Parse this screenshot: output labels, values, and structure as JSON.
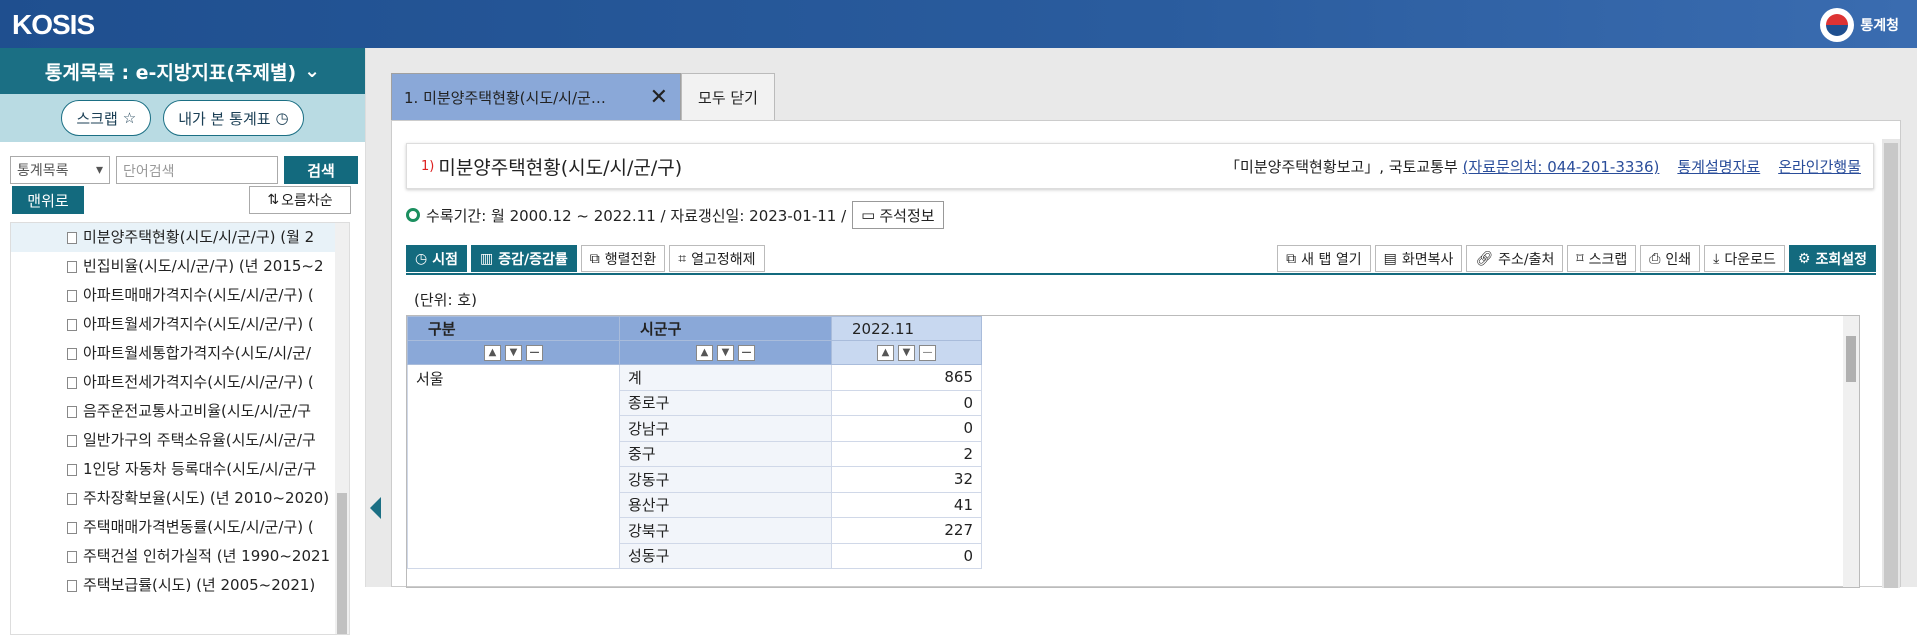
{
  "header": {
    "logo": "KOSIS",
    "brand": "통계청"
  },
  "sidebar": {
    "title": "통계목록 :  e-지방지표(주제별)",
    "scrap_label": "스크랩",
    "recent_label": "내가 본 통계표",
    "search_scope": "통계목록",
    "search_placeholder": "단어검색",
    "search_button": "검색",
    "up_button": "맨위로",
    "sort_button": "오름차순",
    "items": [
      {
        "label": "미분양주택현황(시도/시/군/구) (월 2"
      },
      {
        "label": "빈집비율(시도/시/군/구) (년 2015~2"
      },
      {
        "label": "아파트매매가격지수(시도/시/군/구) ("
      },
      {
        "label": "아파트월세가격지수(시도/시/군/구) ("
      },
      {
        "label": "아파트월세통합가격지수(시도/시/군/"
      },
      {
        "label": "아파트전세가격지수(시도/시/군/구) ("
      },
      {
        "label": "음주운전교통사고비율(시도/시/군/구"
      },
      {
        "label": "일반가구의 주택소유율(시도/시/군/구"
      },
      {
        "label": "1인당 자동차 등록대수(시도/시/군/구"
      },
      {
        "label": "주차장확보율(시도) (년 2010~2020)"
      },
      {
        "label": "주택매매가격변동률(시도/시/군/구) ("
      },
      {
        "label": "주택건설 인허가실적 (년 1990~2021"
      },
      {
        "label": "주택보급률(시도) (년 2005~2021)"
      }
    ]
  },
  "tabs": {
    "active": "1. 미분양주택현황(시도/시/군…",
    "close_all": "모두 닫기"
  },
  "content": {
    "title_num": "1)",
    "title": "미분양주택현황(시도/시/군/구)",
    "source": "「미분양주택현황보고」, 국토교통부",
    "contact": "(자료문의처: 044-201-3336)",
    "stat_doc": "통계설명자료",
    "online": "온라인간행물",
    "period": "수록기간: 월 2000.12 ~ 2022.11 / 자료갱신일: 2023-01-11 /",
    "note_button": "주석정보",
    "unit": "(단위: 호)"
  },
  "toolbar_left": [
    "시점",
    "증감/증감률",
    "행렬전환",
    "열고정해제"
  ],
  "toolbar_right": [
    "새 탭 열기",
    "화면복사",
    "주소/출처",
    "스크랩",
    "인쇄",
    "다운로드",
    "조회설정"
  ],
  "table": {
    "headers": [
      "구분",
      "시군구",
      "2022.11"
    ],
    "region": "서울",
    "rows": [
      {
        "district": "계",
        "value": "865"
      },
      {
        "district": "종로구",
        "value": "0"
      },
      {
        "district": "강남구",
        "value": "0"
      },
      {
        "district": "중구",
        "value": "2"
      },
      {
        "district": "강동구",
        "value": "32"
      },
      {
        "district": "용산구",
        "value": "41"
      },
      {
        "district": "강북구",
        "value": "227"
      },
      {
        "district": "성동구",
        "value": "0"
      }
    ]
  }
}
